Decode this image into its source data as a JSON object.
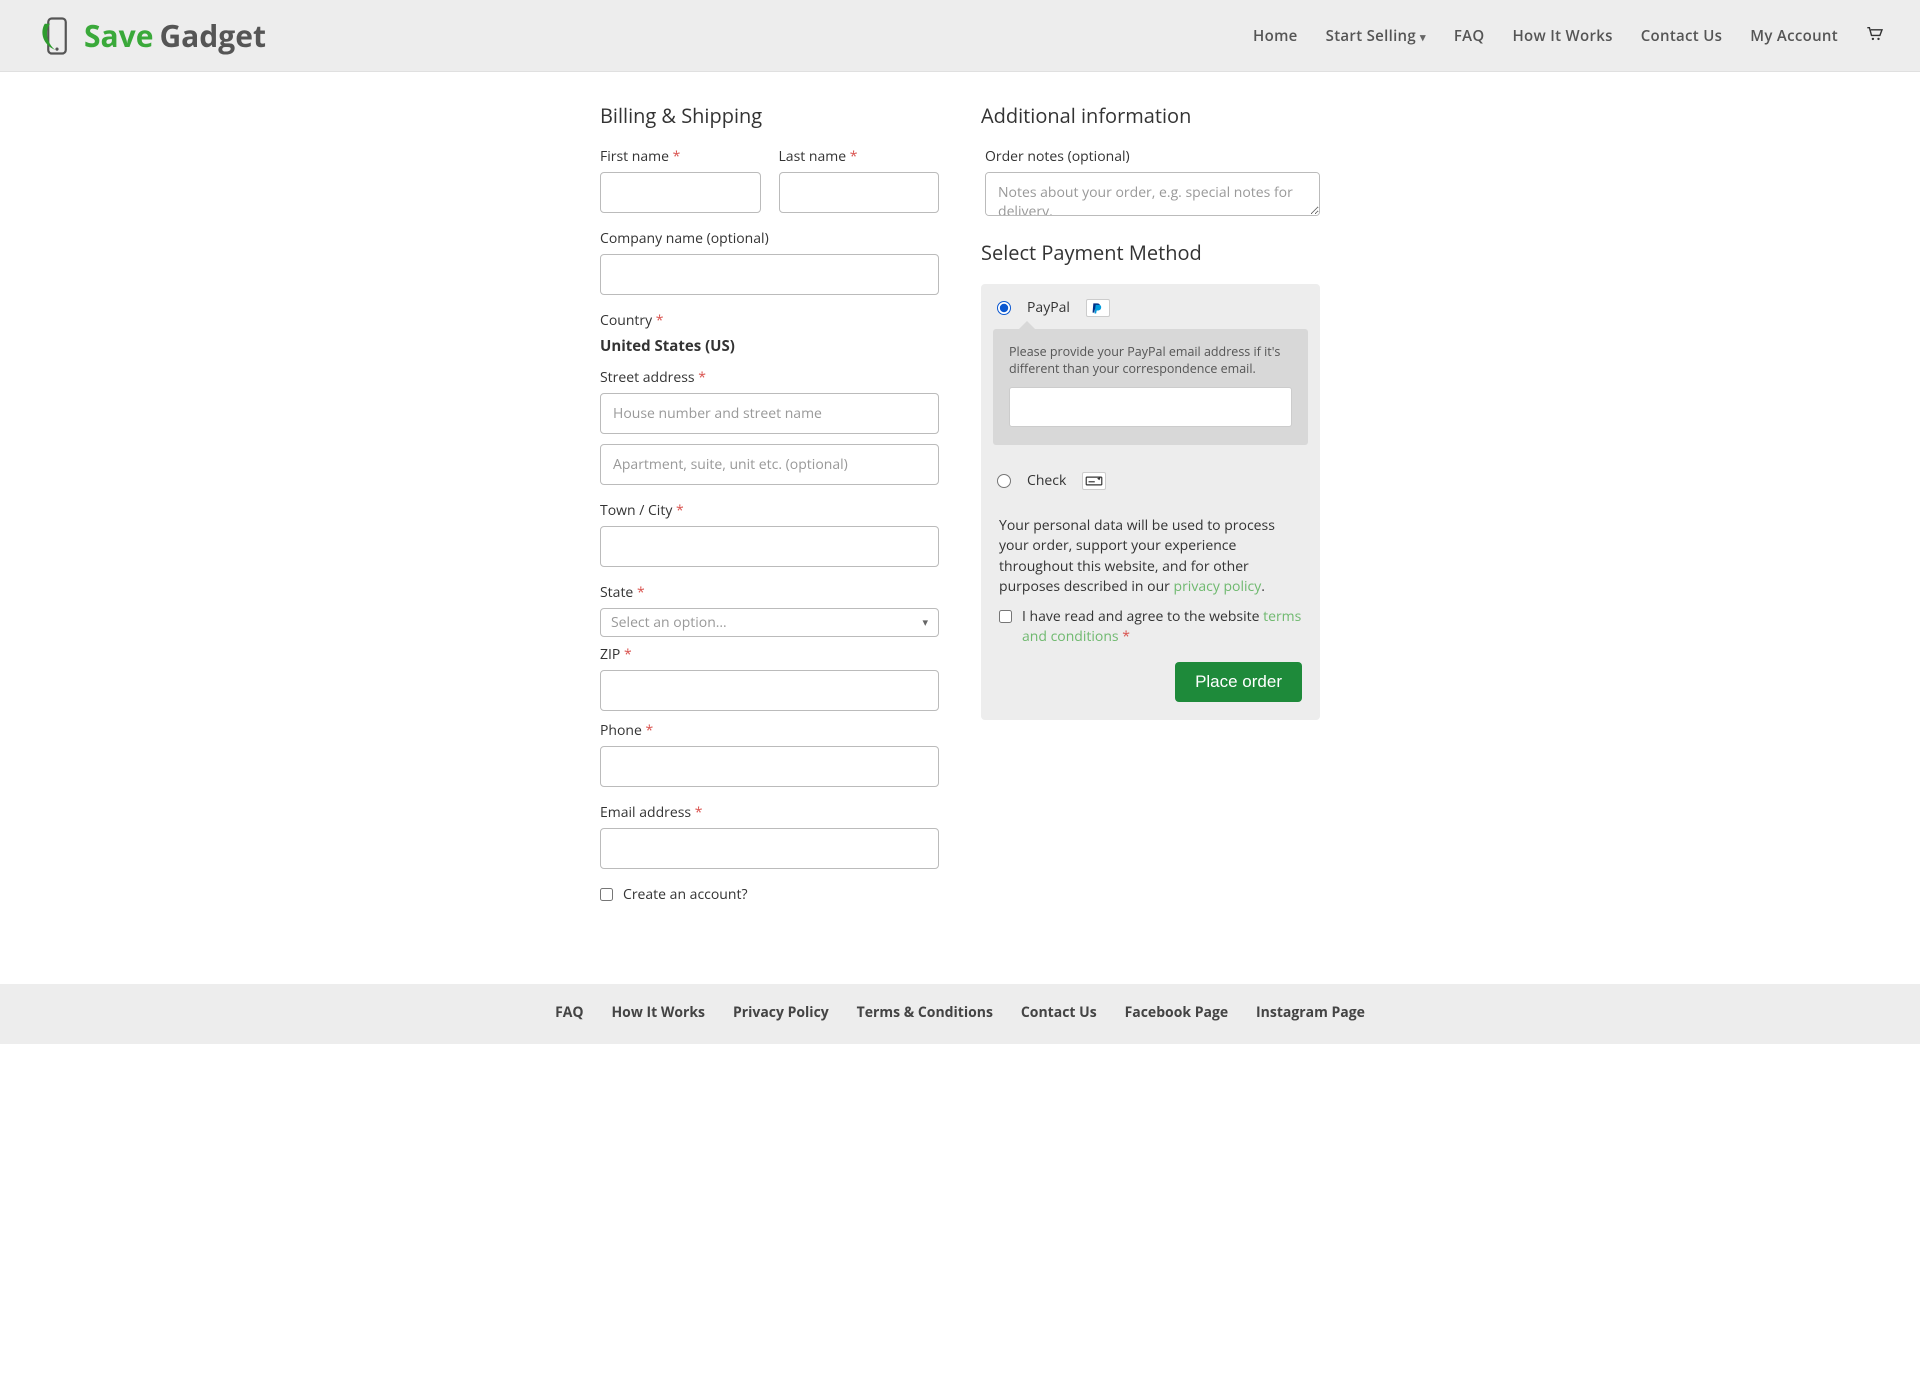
{
  "brand": {
    "save": "Save",
    "gadget": "Gadget"
  },
  "nav": {
    "home": "Home",
    "start_selling": "Start Selling",
    "faq": "FAQ",
    "how_it_works": "How It Works",
    "contact": "Contact Us",
    "my_account": "My Account"
  },
  "billing": {
    "heading": "Billing & Shipping",
    "first_name": "First name",
    "last_name": "Last name",
    "company": "Company name (optional)",
    "country": "Country",
    "country_value": "United States (US)",
    "street": "Street address",
    "street_ph1": "House number and street name",
    "street_ph2": "Apartment, suite, unit etc. (optional)",
    "city": "Town / City",
    "state": "State",
    "state_ph": "Select an option…",
    "zip": "ZIP",
    "phone": "Phone",
    "email": "Email address",
    "create_account": "Create an account?"
  },
  "additional": {
    "heading": "Additional information",
    "notes_label": "Order notes (optional)",
    "notes_ph": "Notes about your order, e.g. special notes for delivery."
  },
  "payment": {
    "heading": "Select Payment Method",
    "paypal": "PayPal",
    "paypal_help": "Please provide your PayPal email address if it's different than your correspondence email.",
    "check": "Check",
    "privacy_text_a": "Your personal data will be used to process your order, support your experience throughout this website, and for other purposes described in our ",
    "privacy_link": "privacy policy",
    "terms_a": "I have read and agree to the website ",
    "terms_link": "terms and conditions",
    "place_order": "Place order"
  },
  "footer": {
    "faq": "FAQ",
    "how": "How It Works",
    "privacy": "Privacy Policy",
    "terms": "Terms & Conditions",
    "contact": "Contact Us",
    "fb": "Facebook Page",
    "ig": "Instagram Page"
  }
}
